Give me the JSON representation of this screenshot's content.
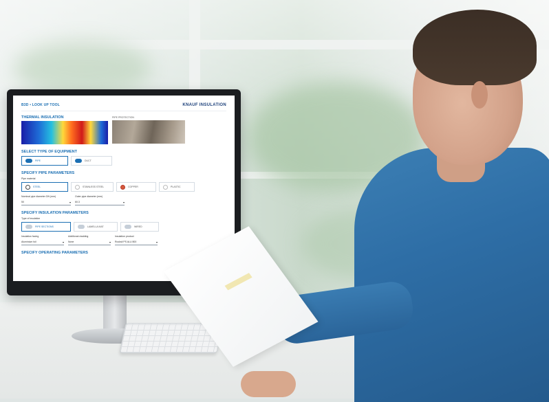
{
  "screen_app": {
    "breadcrumb": "B3D • LOOK UP TOOL",
    "logo": "KNAUF INSULATION",
    "logo_sub": "",
    "thumbnails": [
      {
        "caption": "THERMAL INSULATION"
      },
      {
        "caption": "PIPE PROTECTION"
      }
    ],
    "equipment": {
      "title": "SELECT TYPE OF EQUIPMENT",
      "options": [
        {
          "label": "PIPE",
          "selected": true
        },
        {
          "label": "DUCT",
          "selected": false
        }
      ]
    },
    "pipe_params": {
      "title": "SPECIFY PIPE PARAMETERS",
      "material_label": "Pipe material",
      "materials": [
        {
          "label": "STEEL",
          "selected": true
        },
        {
          "label": "STAINLESS STEEL",
          "selected": false
        },
        {
          "label": "COPPER",
          "selected": false
        },
        {
          "label": "PLASTIC",
          "selected": false
        }
      ],
      "selects": [
        {
          "label": "Nominal pipe diameter DN (mm)",
          "value": "50"
        },
        {
          "label": "Outer pipe diameter (mm)",
          "value": "60.3"
        }
      ]
    },
    "insulation_params": {
      "title": "SPECIFY INSULATION PARAMETERS",
      "type_label": "Type of insulation",
      "types": [
        {
          "label": "PIPE SECTIONS",
          "selected": true
        },
        {
          "label": "LAMELLA MAT",
          "selected": false
        },
        {
          "label": "WIRED",
          "selected": false
        }
      ],
      "selects": [
        {
          "label": "Insulation facing",
          "value": "Aluminium foil"
        },
        {
          "label": "Additional cladding",
          "value": "None"
        },
        {
          "label": "Insulation product",
          "value": "Rocksil PS ALU 800"
        }
      ]
    },
    "next_section": "SPECIFY OPERATING PARAMETERS"
  },
  "colors": {
    "accent": "#1b6fb3",
    "shirt": "#2e6ea6",
    "monitor_bezel": "#1b1d20"
  }
}
